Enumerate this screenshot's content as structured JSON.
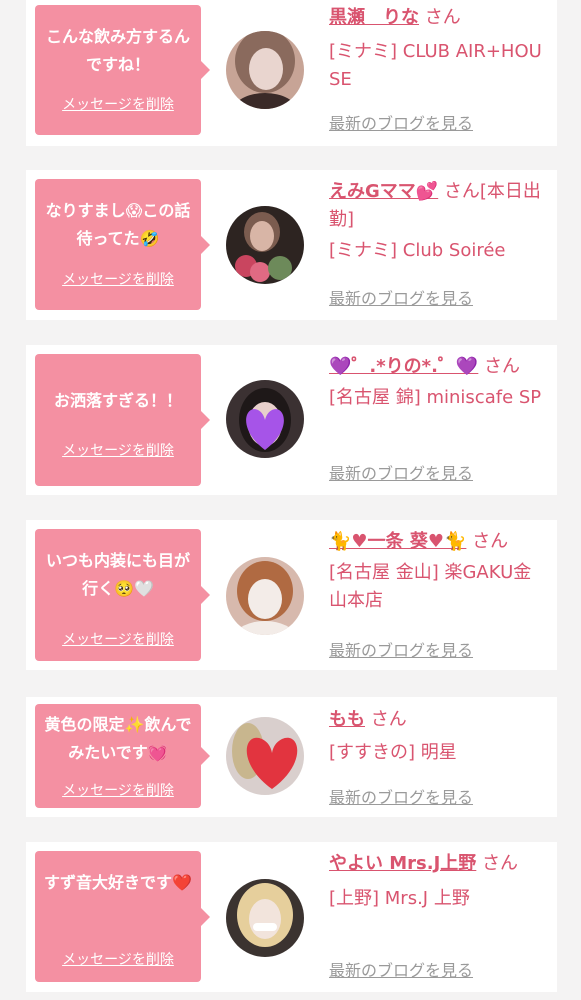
{
  "items": [
    {
      "message": "こんな飲み方するんですね！",
      "delete_label": "メッセージを削除",
      "name": "黒瀬　りな",
      "suffix": " さん",
      "shop": "[ミナミ] CLUB AIR+HOUSE",
      "blog_label": "最新のブログを見る",
      "avatar_colors": [
        "#c7a496",
        "#3a2a28",
        "#e9d5cf"
      ]
    },
    {
      "message": "なりすまし😱この話待ってた🤣",
      "delete_label": "メッセージを削除",
      "name": "えみGママ💕",
      "suffix": " さん[本日出勤]",
      "shop": "[ミナミ] Club Soirée",
      "blog_label": "最新のブログを見る",
      "avatar_colors": [
        "#2d2421",
        "#c9455f",
        "#8a6b58"
      ]
    },
    {
      "message": "お洒落すぎる！！",
      "delete_label": "メッセージを削除",
      "name": "💜゜.*りの*.゜💜",
      "suffix": " さん",
      "shop": "[名古屋 錦] miniscafe SP",
      "blog_label": "最新のブログを見る",
      "avatar_colors": [
        "#3b3132",
        "#a654e8",
        "#e8d0cb"
      ]
    },
    {
      "message": "いつも内装にも目が行く🥺🤍",
      "delete_label": "メッセージを削除",
      "name": "🐈♥一条 葵♥🐈",
      "suffix": " さん",
      "shop": "[名古屋 金山] 楽GAKU金山本店",
      "blog_label": "最新のブログを見る",
      "avatar_colors": [
        "#d7b9ad",
        "#b06a42",
        "#f3ece8"
      ]
    },
    {
      "message": "黄色の限定✨飲んでみたいです💓",
      "delete_label": "メッセージを削除",
      "name": "もも",
      "suffix": " さん",
      "shop": "[すすきの] 明星",
      "blog_label": "最新のブログを見る",
      "avatar_colors": [
        "#d9cfcd",
        "#e2343f",
        "#c8b68e"
      ]
    },
    {
      "message": "すず音大好きです❤️",
      "delete_label": "メッセージを削除",
      "name": "やよい Mrs.J上野",
      "suffix": " さん",
      "shop": "[上野] Mrs.J 上野",
      "blog_label": "最新のブログを見る",
      "avatar_colors": [
        "#3b3330",
        "#e6cf9c",
        "#f2e4dc"
      ]
    }
  ]
}
